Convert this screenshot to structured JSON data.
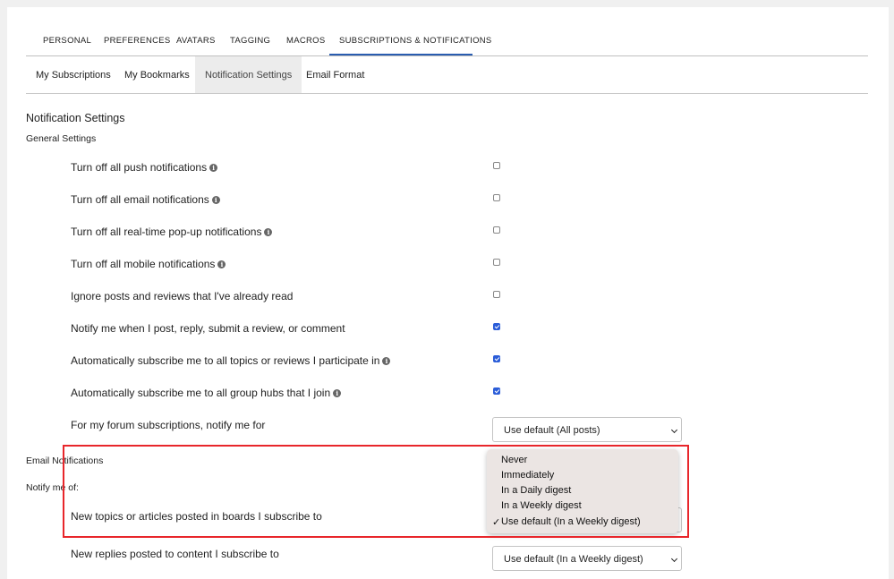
{
  "top_tabs": [
    "PERSONAL",
    "PREFERENCES",
    "AVATARS",
    "TAGGING",
    "MACROS",
    "SUBSCRIPTIONS & NOTIFICATIONS"
  ],
  "sub_tabs": [
    "My Subscriptions",
    "My Bookmarks",
    "Notification Settings",
    "Email Format"
  ],
  "active_sub_tab": "Notification Settings",
  "page_title": "Notification Settings",
  "general_heading": "General Settings",
  "general_rows": [
    {
      "label": "Turn off all push notifications",
      "info": true,
      "checked": false
    },
    {
      "label": "Turn off all email notifications",
      "info": true,
      "checked": false
    },
    {
      "label": "Turn off all real-time pop-up notifications",
      "info": true,
      "checked": false
    },
    {
      "label": "Turn off all mobile notifications",
      "info": true,
      "checked": false
    },
    {
      "label": "Ignore posts and reviews that I've already read",
      "info": false,
      "checked": false
    },
    {
      "label": "Notify me when I post, reply, submit a review, or comment",
      "info": false,
      "checked": true
    },
    {
      "label": "Automatically subscribe me to all topics or reviews I participate in",
      "info": true,
      "checked": true
    },
    {
      "label": "Automatically subscribe me to all group hubs that I join",
      "info": true,
      "checked": true
    }
  ],
  "forum_row": {
    "label": "For my forum subscriptions, notify me for",
    "value": "Use default (All posts)"
  },
  "email_heading": "Email Notifications",
  "notify_heading": "Notify me of:",
  "new_topics_row": {
    "label": "New topics or articles posted in boards I subscribe to"
  },
  "new_replies_row": {
    "label": "New replies posted to content I subscribe to",
    "value": "Use default (In a Weekly digest)"
  },
  "dropdown_options": [
    "Never",
    "Immediately",
    "In a Daily digest",
    "In a Weekly digest",
    "Use default (In a Weekly digest)"
  ],
  "dropdown_selected": "Use default (In a Weekly digest)",
  "checkmark": "✓",
  "info_glyph": "i",
  "colors": {
    "accent": "#2a5db0",
    "checkbox": "#2b5dd8",
    "highlight": "#e8262b"
  }
}
